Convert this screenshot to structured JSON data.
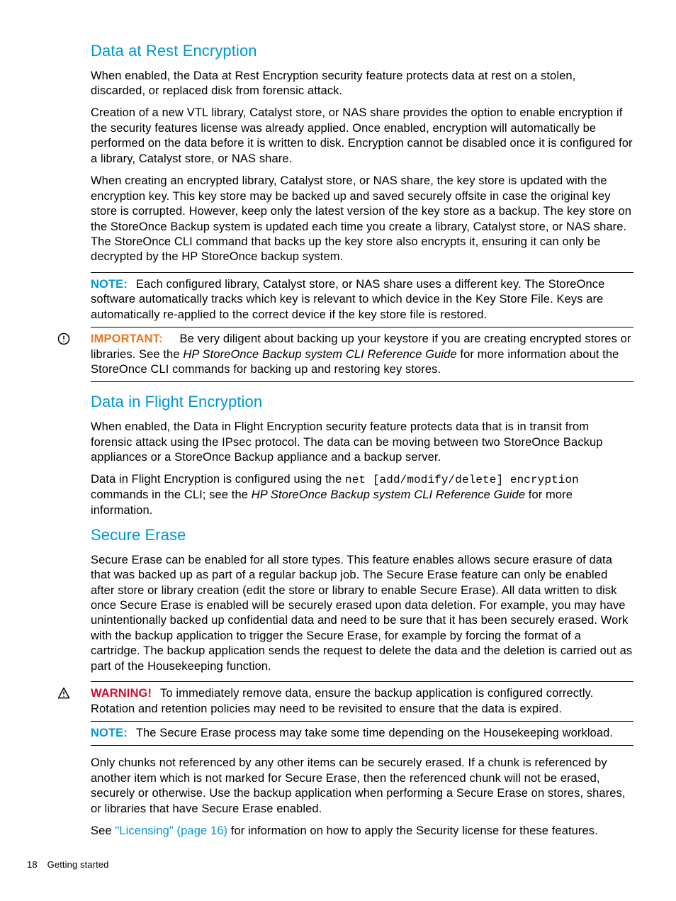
{
  "section1": {
    "title": "Data at Rest Encryption",
    "p1": "When enabled, the Data at Rest Encryption security feature protects data at rest on a stolen, discarded, or replaced disk from forensic attack.",
    "p2": "Creation of a new VTL library, Catalyst store, or NAS share provides the option to enable encryption if the security features license was already applied. Once enabled, encryption will automatically be performed on the data before it is written to disk. Encryption cannot be disabled once it is configured for a library, Catalyst store, or NAS share.",
    "p3": "When creating an encrypted library, Catalyst store, or NAS share, the key store is updated with the encryption key. This key store may be backed up and saved securely offsite in case the original key store is corrupted. However, keep only the latest version of the key store as a backup. The key store on the StoreOnce Backup system is updated each time you create a library, Catalyst store, or NAS share. The StoreOnce CLI command that backs up the key store also encrypts it, ensuring it can only be decrypted by the HP StoreOnce backup system.",
    "note": {
      "label": "NOTE:",
      "text": "Each configured library, Catalyst store, or NAS share uses a different key. The StoreOnce software automatically tracks which key is relevant to which device in the Key Store File. Keys are automatically re-applied to the correct device if the key store file is restored."
    },
    "important": {
      "label": "IMPORTANT:",
      "text_before": "Be very diligent about backing up your keystore if you are creating encrypted stores or libraries. See the ",
      "em": "HP StoreOnce Backup system CLI Reference Guide",
      "text_after": " for more information about the StoreOnce CLI commands for backing up and restoring key stores."
    }
  },
  "section2": {
    "title": "Data in Flight Encryption",
    "p1": "When enabled, the Data in Flight Encryption security feature protects data that is in transit from forensic attack using the IPsec protocol. The data can be moving between two StoreOnce Backup appliances or a StoreOnce Backup appliance and a backup server.",
    "p2_a": "Data in Flight Encryption is configured using the ",
    "p2_code": "net [add/modify/delete] encryption",
    "p2_b": " commands in the CLI; see the ",
    "p2_em": "HP StoreOnce Backup system CLI Reference Guide",
    "p2_c": " for more information."
  },
  "section3": {
    "title": "Secure Erase",
    "p1": "Secure Erase can be enabled for all store types. This feature enables allows secure erasure of data that was backed up as part of a regular backup job. The Secure Erase feature can only be enabled after store or library creation (edit the store or library to enable Secure Erase). All data written to disk once Secure Erase is enabled will be securely erased upon data deletion. For example, you may have unintentionally backed up confidential data and need to be sure that it has been securely erased. Work with the backup application to trigger the Secure Erase, for example by forcing the format of a cartridge. The backup application sends the request to delete the data and the deletion is carried out as part of the Housekeeping function.",
    "warning": {
      "label": "WARNING!",
      "text": "To immediately remove data, ensure the backup application is configured correctly. Rotation and retention policies may need to be revisited to ensure that the data is expired."
    },
    "note": {
      "label": "NOTE:",
      "text": "The Secure Erase process may take some time depending on the Housekeeping workload."
    },
    "p2": "Only chunks not referenced by any other items can be securely erased. If a chunk is referenced by another item which is not marked for Secure Erase, then the referenced chunk will not be erased, securely or otherwise. Use the backup application when performing a Secure Erase on stores, shares, or libraries that have Secure Erase enabled.",
    "p3_a": "See ",
    "p3_link": "\"Licensing\" (page 16)",
    "p3_b": " for information on how to apply the Security license for these features."
  },
  "footer": {
    "page": "18",
    "chapter": "Getting started"
  }
}
